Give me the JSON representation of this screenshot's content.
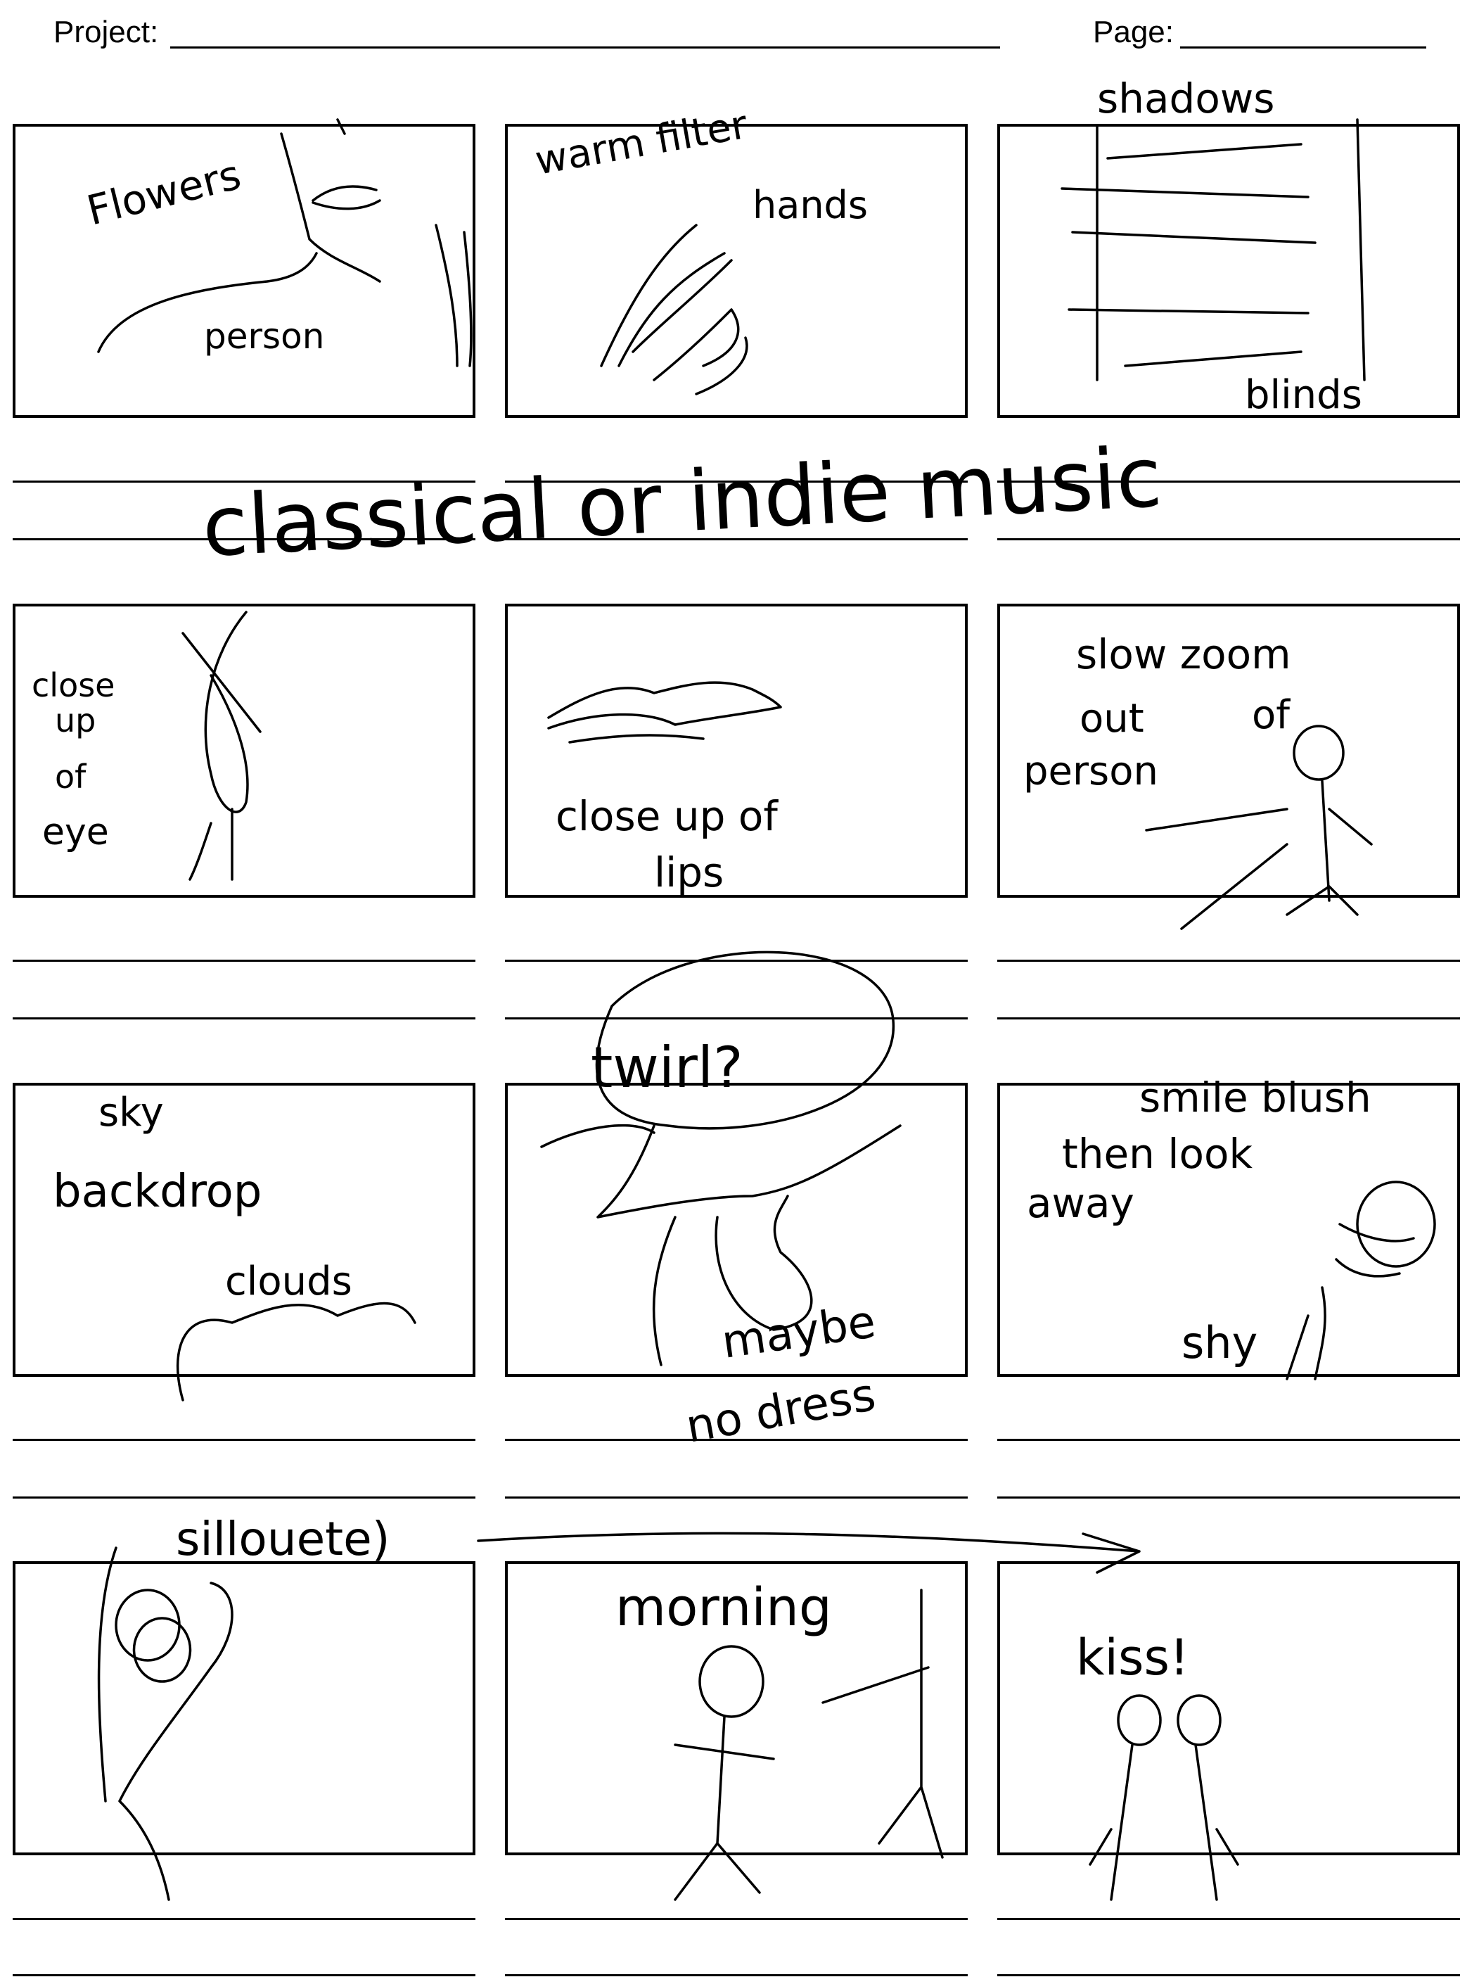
{
  "header": {
    "project_label": "Project:",
    "page_label": "Page:"
  },
  "notes": {
    "f1_flowers": "Flowers",
    "f1_person": "person",
    "f2_warm_filter": "warm filter",
    "f2_hands": "hands",
    "f3_shadows": "shadows",
    "f3_blinds": "blinds",
    "music": "classical or indie music",
    "f4_close": "close",
    "f4_up": "up",
    "f4_of": "of",
    "f4_eye": "eye",
    "f5_close_up_of": "close up of",
    "f5_lips": "lips",
    "f6_slow_zoom": "slow zoom",
    "f6_out": "out",
    "f6_of": "of",
    "f6_person": "person",
    "twirl": "twirl?",
    "f7_sky": "sky",
    "f7_backdrop": "backdrop",
    "f7_clouds": "clouds",
    "f8_maybe": "maybe",
    "f8_no_dress": "no dress",
    "f9_smile_blush": "smile blush",
    "f9_then_look": "then look",
    "f9_away": "away",
    "f9_shy": "shy",
    "silhouette": "sillouete)",
    "f11_morning": "morning",
    "f12_kiss": "kiss!"
  }
}
